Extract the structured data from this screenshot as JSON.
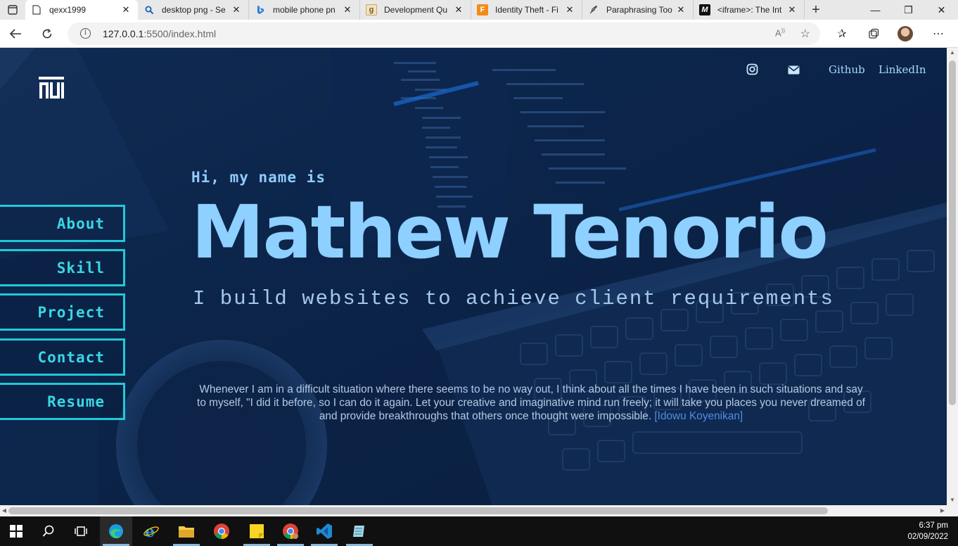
{
  "browser": {
    "tabs": [
      {
        "title": "qexx1999",
        "active": true,
        "favicon": "document-icon"
      },
      {
        "title": "desktop png - Se",
        "active": false,
        "favicon": "search-icon"
      },
      {
        "title": "mobile phone pn",
        "active": false,
        "favicon": "bing-icon"
      },
      {
        "title": "Development Qu",
        "active": false,
        "favicon": "g-icon"
      },
      {
        "title": "Identity Theft - Fi",
        "active": false,
        "favicon": "f-icon"
      },
      {
        "title": "Paraphrasing Too",
        "active": false,
        "favicon": "quill-icon"
      },
      {
        "title": "<iframe>: The Int",
        "active": false,
        "favicon": "mdn-icon"
      }
    ],
    "url_host": "127.0.0.1",
    "url_path": ":5500/index.html"
  },
  "site": {
    "nav": {
      "github": "Github",
      "linkedin": "LinkedIn"
    },
    "sidebar": [
      {
        "label": "About"
      },
      {
        "label": "Skill"
      },
      {
        "label": "Project"
      },
      {
        "label": "Contact"
      },
      {
        "label": "Resume"
      }
    ],
    "hero": {
      "greeting": "Hi, my name is",
      "name": "Mathew Tenorio",
      "tagline": "I build websites to achieve client requirements"
    },
    "quote": {
      "text": "Whenever I am in a difficult situation where there seems to be no way out, I think about all the times I have been in such situations and say to myself, \"I did it before, so I can do it again. Let your creative and imaginative mind run freely; it will take you places you never dreamed of and provide breakthroughs that others once thought were impossible.",
      "author": "[Idowu Koyenikan]"
    },
    "colors": {
      "accent": "#1fc9d9",
      "name": "#8ed0ff",
      "background": "#0b2347"
    }
  },
  "taskbar": {
    "time": "6:37 pm",
    "date": "02/09/2022"
  }
}
